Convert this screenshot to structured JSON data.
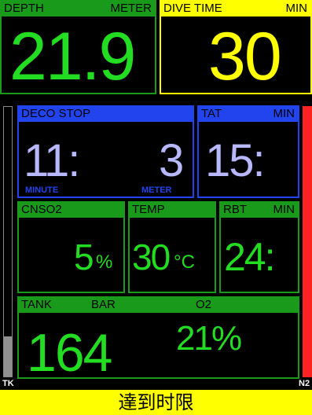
{
  "colors": {
    "green": "#22dd22",
    "green_header": "#1a9a1a",
    "yellow": "#ffff00",
    "blue_header": "#2244ee",
    "blue_value": "#b8b8ff",
    "red_bar": "#ff2222",
    "gray_bar": "#909090"
  },
  "depth": {
    "label": "DEPTH",
    "unit": "METER",
    "value": "21.9"
  },
  "dive_time": {
    "label": "DIVE TIME",
    "unit": "MIN",
    "value": "30"
  },
  "deco_stop": {
    "label": "DECO STOP",
    "minutes": "11:",
    "depth": "3",
    "minute_label": "MINUTE",
    "meter_label": "METER"
  },
  "tat": {
    "label": "TAT",
    "unit": "MIN",
    "value": "15:"
  },
  "cns": {
    "label": "CNSO2",
    "value": "5",
    "unit": "%"
  },
  "temp": {
    "label": "TEMP",
    "value": "30",
    "unit": "°C"
  },
  "rbt": {
    "label": "RBT",
    "unit": "MIN",
    "value": "24:"
  },
  "tank": {
    "label": "TANK",
    "unit": "BAR",
    "o2_label": "O2",
    "pressure": "164",
    "o2_value": "21%"
  },
  "side": {
    "left_label": "TK",
    "right_label": "N2",
    "tk_level_percent": 15,
    "n2_level_percent": 100
  },
  "alert": {
    "text": "達到时限"
  }
}
